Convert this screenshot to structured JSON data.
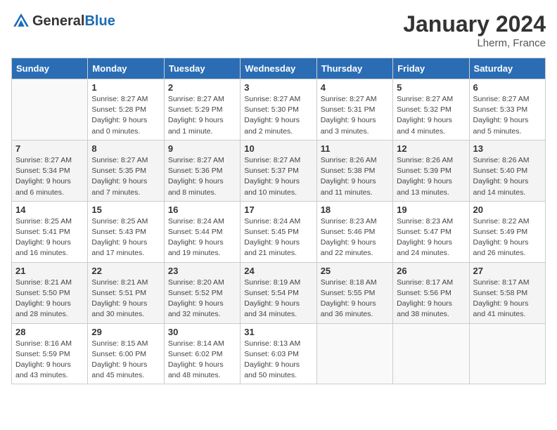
{
  "header": {
    "logo_general": "General",
    "logo_blue": "Blue",
    "month_title": "January 2024",
    "location": "Lherm, France"
  },
  "weekdays": [
    "Sunday",
    "Monday",
    "Tuesday",
    "Wednesday",
    "Thursday",
    "Friday",
    "Saturday"
  ],
  "weeks": [
    [
      {
        "day": "",
        "info": ""
      },
      {
        "day": "1",
        "info": "Sunrise: 8:27 AM\nSunset: 5:28 PM\nDaylight: 9 hours\nand 0 minutes."
      },
      {
        "day": "2",
        "info": "Sunrise: 8:27 AM\nSunset: 5:29 PM\nDaylight: 9 hours\nand 1 minute."
      },
      {
        "day": "3",
        "info": "Sunrise: 8:27 AM\nSunset: 5:30 PM\nDaylight: 9 hours\nand 2 minutes."
      },
      {
        "day": "4",
        "info": "Sunrise: 8:27 AM\nSunset: 5:31 PM\nDaylight: 9 hours\nand 3 minutes."
      },
      {
        "day": "5",
        "info": "Sunrise: 8:27 AM\nSunset: 5:32 PM\nDaylight: 9 hours\nand 4 minutes."
      },
      {
        "day": "6",
        "info": "Sunrise: 8:27 AM\nSunset: 5:33 PM\nDaylight: 9 hours\nand 5 minutes."
      }
    ],
    [
      {
        "day": "7",
        "info": "Sunrise: 8:27 AM\nSunset: 5:34 PM\nDaylight: 9 hours\nand 6 minutes."
      },
      {
        "day": "8",
        "info": "Sunrise: 8:27 AM\nSunset: 5:35 PM\nDaylight: 9 hours\nand 7 minutes."
      },
      {
        "day": "9",
        "info": "Sunrise: 8:27 AM\nSunset: 5:36 PM\nDaylight: 9 hours\nand 8 minutes."
      },
      {
        "day": "10",
        "info": "Sunrise: 8:27 AM\nSunset: 5:37 PM\nDaylight: 9 hours\nand 10 minutes."
      },
      {
        "day": "11",
        "info": "Sunrise: 8:26 AM\nSunset: 5:38 PM\nDaylight: 9 hours\nand 11 minutes."
      },
      {
        "day": "12",
        "info": "Sunrise: 8:26 AM\nSunset: 5:39 PM\nDaylight: 9 hours\nand 13 minutes."
      },
      {
        "day": "13",
        "info": "Sunrise: 8:26 AM\nSunset: 5:40 PM\nDaylight: 9 hours\nand 14 minutes."
      }
    ],
    [
      {
        "day": "14",
        "info": "Sunrise: 8:25 AM\nSunset: 5:41 PM\nDaylight: 9 hours\nand 16 minutes."
      },
      {
        "day": "15",
        "info": "Sunrise: 8:25 AM\nSunset: 5:43 PM\nDaylight: 9 hours\nand 17 minutes."
      },
      {
        "day": "16",
        "info": "Sunrise: 8:24 AM\nSunset: 5:44 PM\nDaylight: 9 hours\nand 19 minutes."
      },
      {
        "day": "17",
        "info": "Sunrise: 8:24 AM\nSunset: 5:45 PM\nDaylight: 9 hours\nand 21 minutes."
      },
      {
        "day": "18",
        "info": "Sunrise: 8:23 AM\nSunset: 5:46 PM\nDaylight: 9 hours\nand 22 minutes."
      },
      {
        "day": "19",
        "info": "Sunrise: 8:23 AM\nSunset: 5:47 PM\nDaylight: 9 hours\nand 24 minutes."
      },
      {
        "day": "20",
        "info": "Sunrise: 8:22 AM\nSunset: 5:49 PM\nDaylight: 9 hours\nand 26 minutes."
      }
    ],
    [
      {
        "day": "21",
        "info": "Sunrise: 8:21 AM\nSunset: 5:50 PM\nDaylight: 9 hours\nand 28 minutes."
      },
      {
        "day": "22",
        "info": "Sunrise: 8:21 AM\nSunset: 5:51 PM\nDaylight: 9 hours\nand 30 minutes."
      },
      {
        "day": "23",
        "info": "Sunrise: 8:20 AM\nSunset: 5:52 PM\nDaylight: 9 hours\nand 32 minutes."
      },
      {
        "day": "24",
        "info": "Sunrise: 8:19 AM\nSunset: 5:54 PM\nDaylight: 9 hours\nand 34 minutes."
      },
      {
        "day": "25",
        "info": "Sunrise: 8:18 AM\nSunset: 5:55 PM\nDaylight: 9 hours\nand 36 minutes."
      },
      {
        "day": "26",
        "info": "Sunrise: 8:17 AM\nSunset: 5:56 PM\nDaylight: 9 hours\nand 38 minutes."
      },
      {
        "day": "27",
        "info": "Sunrise: 8:17 AM\nSunset: 5:58 PM\nDaylight: 9 hours\nand 41 minutes."
      }
    ],
    [
      {
        "day": "28",
        "info": "Sunrise: 8:16 AM\nSunset: 5:59 PM\nDaylight: 9 hours\nand 43 minutes."
      },
      {
        "day": "29",
        "info": "Sunrise: 8:15 AM\nSunset: 6:00 PM\nDaylight: 9 hours\nand 45 minutes."
      },
      {
        "day": "30",
        "info": "Sunrise: 8:14 AM\nSunset: 6:02 PM\nDaylight: 9 hours\nand 48 minutes."
      },
      {
        "day": "31",
        "info": "Sunrise: 8:13 AM\nSunset: 6:03 PM\nDaylight: 9 hours\nand 50 minutes."
      },
      {
        "day": "",
        "info": ""
      },
      {
        "day": "",
        "info": ""
      },
      {
        "day": "",
        "info": ""
      }
    ]
  ]
}
